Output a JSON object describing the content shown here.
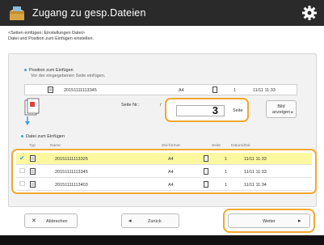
{
  "window": {
    "title": "Zugang zu gesp.Dateien",
    "app_icon": "folder-box-icon",
    "settings_icon": "gear-icon"
  },
  "instructions": {
    "line1": "<Seiten einfügen: Einstellungen Datei>",
    "line2": "Datei und Position zum Einfügen einstellen."
  },
  "position_section": {
    "title": "Position zum Einfügen",
    "subtitle": "Vor der eingegebenen Seite einfügen.",
    "row": {
      "filename": "20151111113345",
      "size": "A4",
      "pages": "1",
      "date": "11/11 11:33"
    },
    "page_label": "Seite Nr.:",
    "page_label_2": "/",
    "page_value": "3",
    "page_unit": "Seite",
    "preview_button": {
      "line1": "Bild",
      "line2": "anzeigen"
    }
  },
  "file_section": {
    "title": "Datei zum Einfügen",
    "headers": [
      "Typ",
      "Name",
      "Zwi-format",
      "Seite",
      "Datum/Zeit"
    ],
    "rows": [
      {
        "selected": true,
        "name": "20151111113325",
        "size": "A4",
        "pages": "1",
        "date": "11/11 11:33"
      },
      {
        "selected": false,
        "name": "20151111113345",
        "size": "A4",
        "pages": "1",
        "date": "11/11 11:33"
      },
      {
        "selected": false,
        "name": "20151111113403",
        "size": "A4",
        "pages": "1",
        "date": "11/11 11:34"
      }
    ]
  },
  "footer": {
    "cancel": "Abbrechen",
    "back": "Zurück",
    "next": "Weiter"
  },
  "colors": {
    "highlight": "#f0a830",
    "selected_row": "#fbf8a0",
    "titlebar": "#2a2a2a",
    "accent": "#3aa0d8"
  }
}
